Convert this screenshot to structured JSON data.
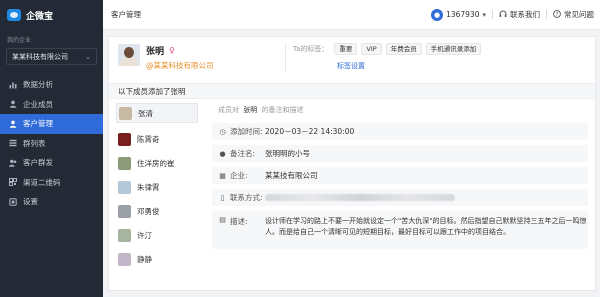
{
  "brand": {
    "name": "企微宝"
  },
  "sidebar": {
    "company_caption": "我的企业",
    "company_name": "某某科技有限公司",
    "items": [
      {
        "label": "数据分析",
        "icon": "bar-chart-icon",
        "active": false
      },
      {
        "label": "企业成员",
        "icon": "person-icon",
        "active": false
      },
      {
        "label": "客户管理",
        "icon": "customer-icon",
        "active": true
      },
      {
        "label": "群列表",
        "icon": "list-icon",
        "active": false
      },
      {
        "label": "客户群发",
        "icon": "broadcast-icon",
        "active": false
      },
      {
        "label": "渠道二维码",
        "icon": "qrcode-icon",
        "active": false
      },
      {
        "label": "设置",
        "icon": "settings-icon",
        "active": false
      }
    ]
  },
  "header": {
    "title": "客户管理",
    "account": "1367930",
    "contact_label": "联系我们",
    "faq_label": "常见问题"
  },
  "customer": {
    "name": "张明",
    "company": "@某某科技有限公司",
    "tags_label": "Ta的标签：",
    "tags": [
      "重要",
      "VIP",
      "年费会员",
      "手机通讯录添加"
    ],
    "tag_settings_label": "标签设置"
  },
  "members_section": {
    "title": "以下成员添加了张明",
    "members": [
      {
        "name": "张清",
        "avatar_color": "#c8b9a2"
      },
      {
        "name": "陈霄奇",
        "avatar_color": "#7a1f1f"
      },
      {
        "name": "住洋房的崔",
        "avatar_color": "#8d9a7a"
      },
      {
        "name": "朱律霄",
        "avatar_color": "#b5c8d8"
      },
      {
        "name": "邓勇俊",
        "avatar_color": "#9aa0a6"
      },
      {
        "name": "许汀",
        "avatar_color": "#a7b4a0"
      },
      {
        "name": "静静",
        "avatar_color": "#c2b7c9"
      }
    ]
  },
  "details": {
    "remark_prefix": "成员对",
    "remark_name": "张明",
    "remark_suffix": "的备注和描述",
    "fields": [
      {
        "icon": "clock-icon",
        "label": "添加时间:",
        "value": "2020－03－22 14:30:00"
      },
      {
        "icon": "user-icon",
        "label": "备注名:",
        "value": "张明明的小号"
      },
      {
        "icon": "building-icon",
        "label": "企业:",
        "value": "某某技有限公司"
      },
      {
        "icon": "phone-icon",
        "label": "联系方式:",
        "value": ""
      },
      {
        "icon": "document-icon",
        "label": "描述:",
        "value": "设计师在学习的路上不要一开始就设定一个\"苦大仇深\"的目标。然后指望自己默默坚持三五年之后一鸣惊人。而是给自己一个清晰可见的短期目标，最好目标可以跟工作中的项目结合。"
      }
    ]
  }
}
